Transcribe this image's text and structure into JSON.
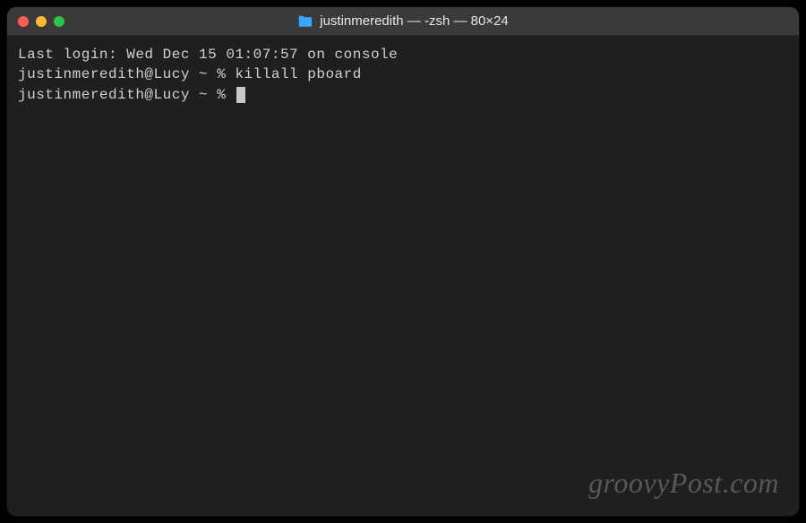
{
  "titlebar": {
    "title": "justinmeredith — -zsh — 80×24",
    "icon": "folder-icon"
  },
  "terminal": {
    "last_login": "Last login: Wed Dec 15 01:07:57 on console",
    "lines": [
      {
        "prompt": "justinmeredith@Lucy ~ % ",
        "command": "killall pboard"
      },
      {
        "prompt": "justinmeredith@Lucy ~ % ",
        "command": ""
      }
    ]
  },
  "watermark": "groovyPost.com"
}
